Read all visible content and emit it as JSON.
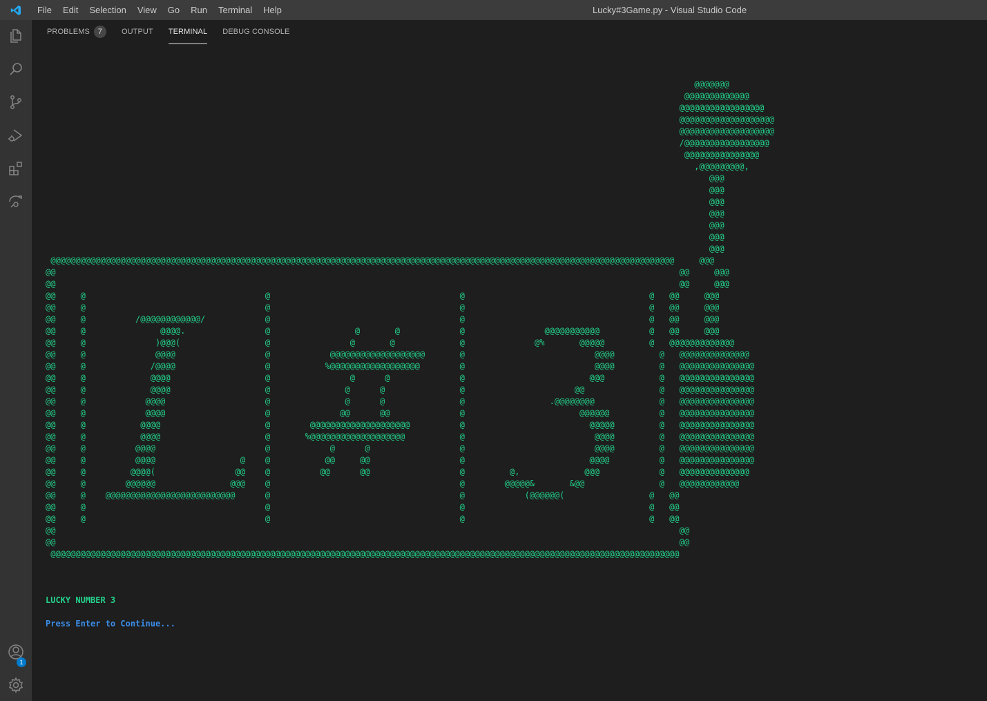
{
  "menu": [
    "File",
    "Edit",
    "Selection",
    "View",
    "Go",
    "Run",
    "Terminal",
    "Help"
  ],
  "window_title": "Lucky#3Game.py - Visual Studio Code",
  "activity": {
    "account_badge": "1"
  },
  "panel": {
    "tabs": [
      {
        "label": "PROBLEMS",
        "count": "7"
      },
      {
        "label": "OUTPUT"
      },
      {
        "label": "TERMINAL"
      },
      {
        "label": "DEBUG CONSOLE"
      }
    ],
    "active_tab": "TERMINAL"
  },
  "terminal": {
    "ascii_art": "                                                                                                                                  @@@@@@@\n                                                                                                                                @@@@@@@@@@@@@\n                                                                                                                               @@@@@@@@@@@@@@@@@\n                                                                                                                               @@@@@@@@@@@@@@@@@@@\n                                                                                                                               @@@@@@@@@@@@@@@@@@@\n                                                                                                                               /@@@@@@@@@@@@@@@@@\n                                                                                                                                @@@@@@@@@@@@@@@\n                                                                                                                                  ,@@@@@@@@@,\n                                                                                                                                     @@@\n                                                                                                                                     @@@\n                                                                                                                                     @@@\n                                                                                                                                     @@@\n                                                                                                                                     @@@\n                                                                                                                                     @@@\n                                                                                                                                     @@@\n @@@@@@@@@@@@@@@@@@@@@@@@@@@@@@@@@@@@@@@@@@@@@@@@@@@@@@@@@@@@@@@@@@@@@@@@@@@@@@@@@@@@@@@@@@@@@@@@@@@@@@@@@@@@@@@@@@@@@@@@@@@@@     @@@\n@@                                                                                                                             @@     @@@\n@@                                                                                                                             @@     @@@\n@@     @                                    @                                      @                                     @   @@     @@@\n@@     @                                    @                                      @                                     @   @@     @@@\n@@     @          /@@@@@@@@@@@@/            @                                      @                                     @   @@     @@@\n@@     @               @@@@.                @                 @       @            @                @@@@@@@@@@@          @   @@     @@@\n@@     @              )@@@(                 @                @       @             @              @%       @@@@@         @   @@@@@@@@@@@@@\n@@     @              @@@@                  @            @@@@@@@@@@@@@@@@@@@       @                          @@@@         @   @@@@@@@@@@@@@@\n@@     @             /@@@@                  @           %@@@@@@@@@@@@@@@@@@        @                          @@@@         @   @@@@@@@@@@@@@@@\n@@     @             @@@@                   @                @      @              @                         @@@           @   @@@@@@@@@@@@@@@\n@@     @             @@@@                   @               @      @               @                      @@               @   @@@@@@@@@@@@@@@\n@@     @            @@@@                    @               @      @               @                 .@@@@@@@@             @   @@@@@@@@@@@@@@@\n@@     @            @@@@                    @              @@      @@              @                       @@@@@@          @   @@@@@@@@@@@@@@@\n@@     @           @@@@                     @        @@@@@@@@@@@@@@@@@@@@          @                         @@@@@         @   @@@@@@@@@@@@@@@\n@@     @           @@@@                     @       %@@@@@@@@@@@@@@@@@@@           @                          @@@@         @   @@@@@@@@@@@@@@@\n@@     @          @@@@                      @            @      @                  @                          @@@@         @   @@@@@@@@@@@@@@@\n@@     @          @@@@                 @    @           @@     @@                  @                         @@@@          @   @@@@@@@@@@@@@@@\n@@     @         @@@@(                @@    @          @@      @@                  @         @,             @@@            @   @@@@@@@@@@@@@@\n@@     @        @@@@@@               @@@    @                                      @        @@@@@&       &@@               @   @@@@@@@@@@@@\n@@     @    @@@@@@@@@@@@@@@@@@@@@@@@@@      @                                      @            (@@@@@@(                 @   @@\n@@     @                                    @                                      @                                     @   @@\n@@     @                                    @                                      @                                     @   @@\n@@                                                                                                                             @@\n@@                                                                                                                             @@\n @@@@@@@@@@@@@@@@@@@@@@@@@@@@@@@@@@@@@@@@@@@@@@@@@@@@@@@@@@@@@@@@@@@@@@@@@@@@@@@@@@@@@@@@@@@@@@@@@@@@@@@@@@@@@@@@@@@@@@@@@@@@@@",
    "line1": "LUCKY NUMBER 3",
    "line2": "Press Enter to Continue..."
  },
  "colors": {
    "accent": "#007acc",
    "terminal_green": "#23d18b",
    "terminal_blue": "#3b8eea"
  }
}
